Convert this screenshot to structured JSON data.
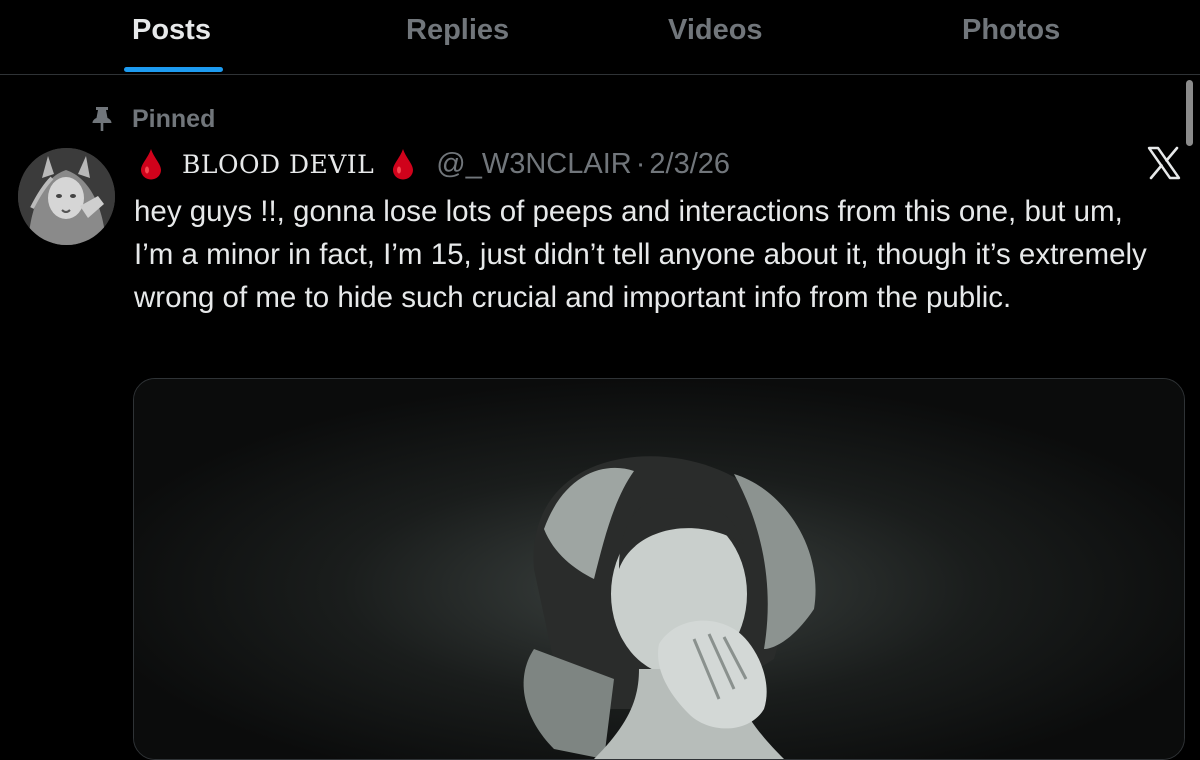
{
  "tabs": [
    {
      "label": "Posts",
      "active": true
    },
    {
      "label": "Replies",
      "active": false
    },
    {
      "label": "Videos",
      "active": false
    },
    {
      "label": "Photos",
      "active": false
    }
  ],
  "colors": {
    "accent": "#1d9bf0",
    "background": "#000000",
    "text_primary": "#e7e9ea",
    "text_secondary": "#71767b",
    "blood_drop": "#d0021b"
  },
  "pinned": {
    "icon": "pin-icon",
    "label": "Pinned"
  },
  "post": {
    "author": {
      "display_name": "BLOOD DEVIL",
      "name_emoji": "blood-drop-icon",
      "handle": "@_W3NCLAIR",
      "avatar": "avatar"
    },
    "separator": "·",
    "date": "2/3/26",
    "source_icon": "x-logo-icon",
    "text": "hey guys !!, gonna lose lots of peeps and interactions from this one, but um, I’m a minor in fact, I’m 15, just didn’t tell anyone about it, though it’s extremely wrong of me to hide such crucial and important info from the public.",
    "media": {
      "type": "image"
    }
  }
}
